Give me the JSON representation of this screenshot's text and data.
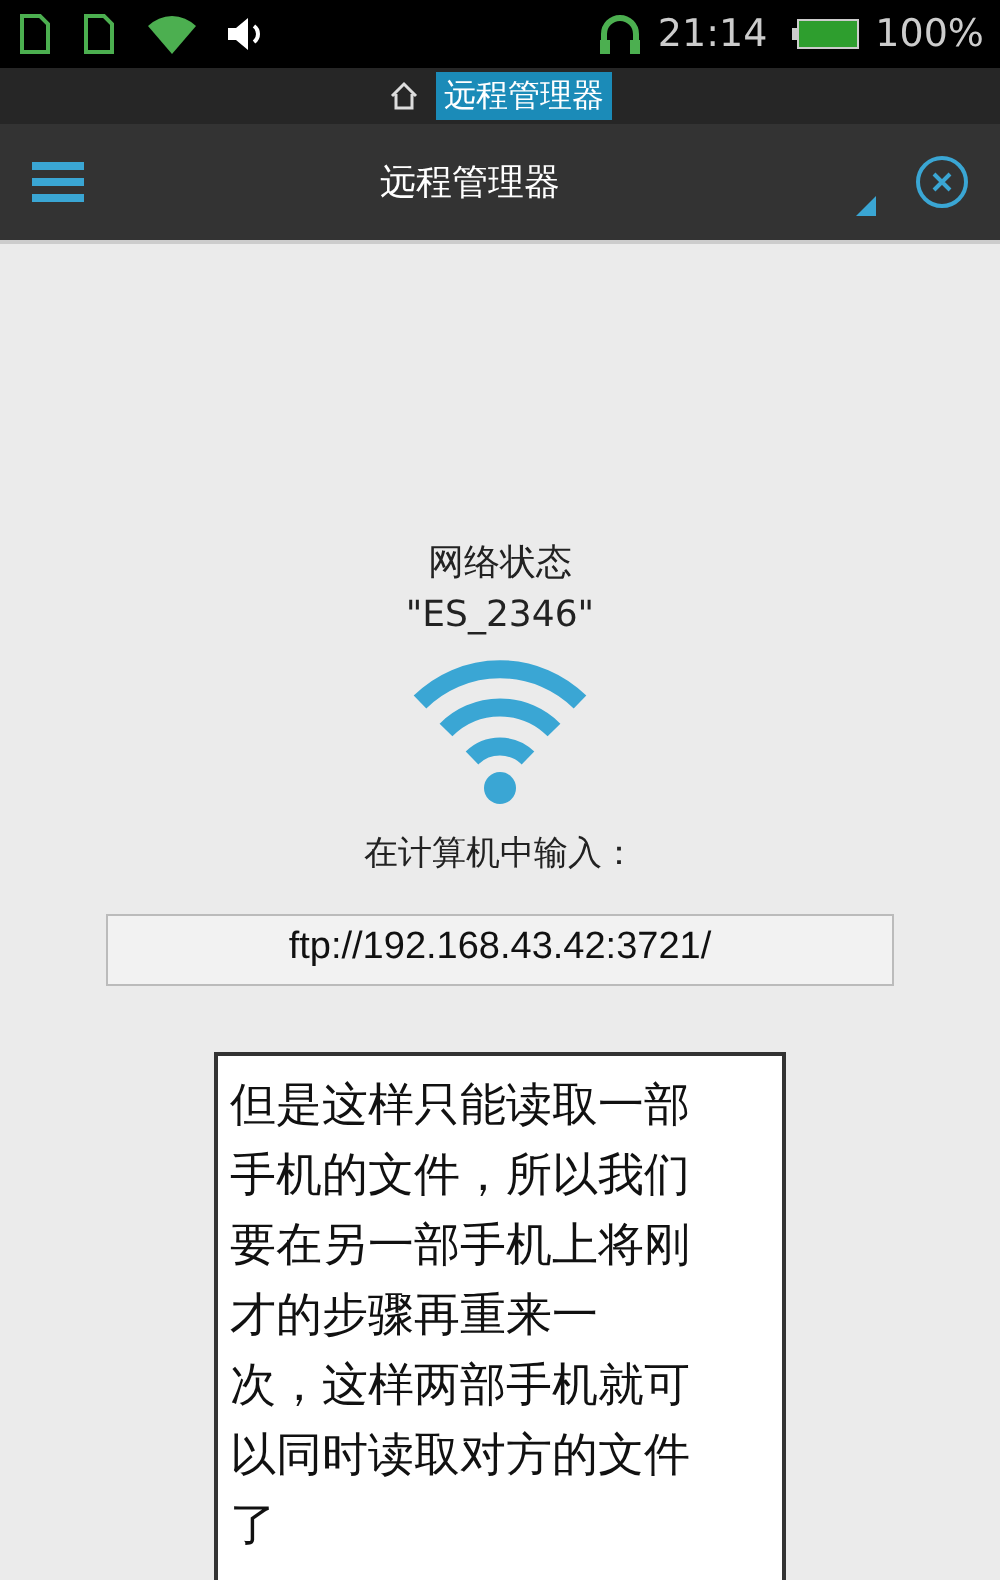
{
  "status_bar": {
    "time": "21:14",
    "battery": "100%"
  },
  "notification_bar": {
    "title": "远程管理器"
  },
  "app_bar": {
    "title": "远程管理器"
  },
  "status": {
    "heading": "网络状态",
    "network": "\"ES_2346\"",
    "instruction": "在计算机中输入：",
    "address": "ftp://192.168.43.42:3721/"
  },
  "note": {
    "lines": [
      "但是这样只能读取一部",
      "手机的文件，所以我们",
      "要在另一部手机上将刚",
      "才的步骤再重来一",
      "次，这样两部手机就可",
      "以同时读取对方的文件",
      "了"
    ]
  }
}
